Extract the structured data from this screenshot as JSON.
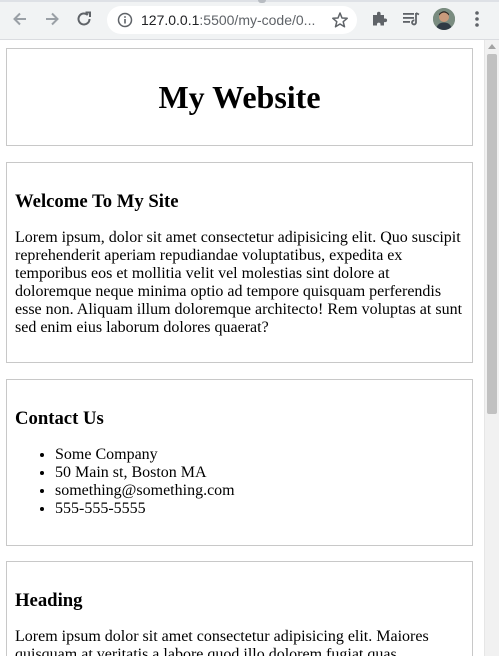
{
  "browser": {
    "url_host": "127.0.0.1",
    "url_rest": ":5500/my-code/0..."
  },
  "header": {
    "title": "My Website"
  },
  "welcome": {
    "heading": "Welcome To My Site",
    "body": "Lorem ipsum, dolor sit amet consectetur adipisicing elit. Quo suscipit reprehenderit aperiam repudiandae voluptatibus, expedita ex temporibus eos et mollitia velit vel molestias sint dolore at doloremque neque minima optio ad tempore quisquam perferendis esse non. Aliquam illum doloremque architecto! Rem voluptas at sunt sed enim eius laborum dolores quaerat?"
  },
  "contact": {
    "heading": "Contact Us",
    "items": [
      "Some Company",
      "50 Main st, Boston MA",
      "something@something.com",
      "555-555-5555"
    ]
  },
  "third": {
    "heading": "Heading",
    "body": "Lorem ipsum dolor sit amet consectetur adipisicing elit. Maiores quisquam at veritatis a labore quod illo dolorem fugiat quas"
  },
  "icons": {
    "back": "arrow-left-icon",
    "forward": "arrow-right-icon",
    "reload": "reload-icon",
    "info": "info-icon",
    "star": "star-icon",
    "extensions": "puzzle-icon",
    "media": "media-queue-icon",
    "menu": "kebab-menu-icon"
  },
  "colors": {
    "chrome_bg": "#f1f3f4",
    "icon": "#5f6368",
    "border": "#c8c8c8"
  }
}
